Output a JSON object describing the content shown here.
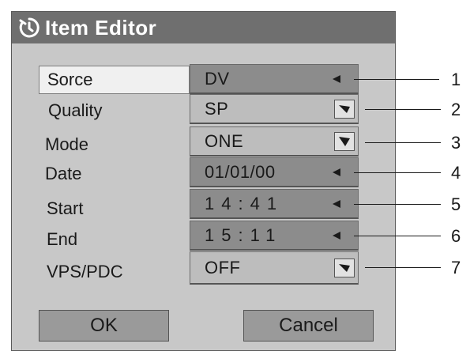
{
  "title": "Item Editor",
  "title_icon": "timer-icon",
  "rows": [
    {
      "label": "Sorce",
      "value": "DV",
      "control": "arrow",
      "callout": "1"
    },
    {
      "label": "Quality",
      "value": "SP",
      "control": "dropdown",
      "callout": "2"
    },
    {
      "label": "Mode",
      "value": "ONE",
      "control": "dropdown",
      "callout": "3"
    },
    {
      "label": "Date",
      "value": "01/01/00",
      "control": "arrow",
      "callout": "4"
    },
    {
      "label": "Start",
      "value": "14:41",
      "control": "arrow",
      "callout": "5"
    },
    {
      "label": "End",
      "value": "15:11",
      "control": "arrow",
      "callout": "6"
    },
    {
      "label": "VPS/PDC",
      "value": "OFF",
      "control": "dropdown",
      "callout": "7"
    }
  ],
  "buttons": {
    "ok": "OK",
    "cancel": "Cancel"
  },
  "colors": {
    "titlebar": "#6f6f6f",
    "dialog": "#c8c8c8",
    "field_dark": "#8c8c8c",
    "field_light": "#bdbdbd"
  }
}
